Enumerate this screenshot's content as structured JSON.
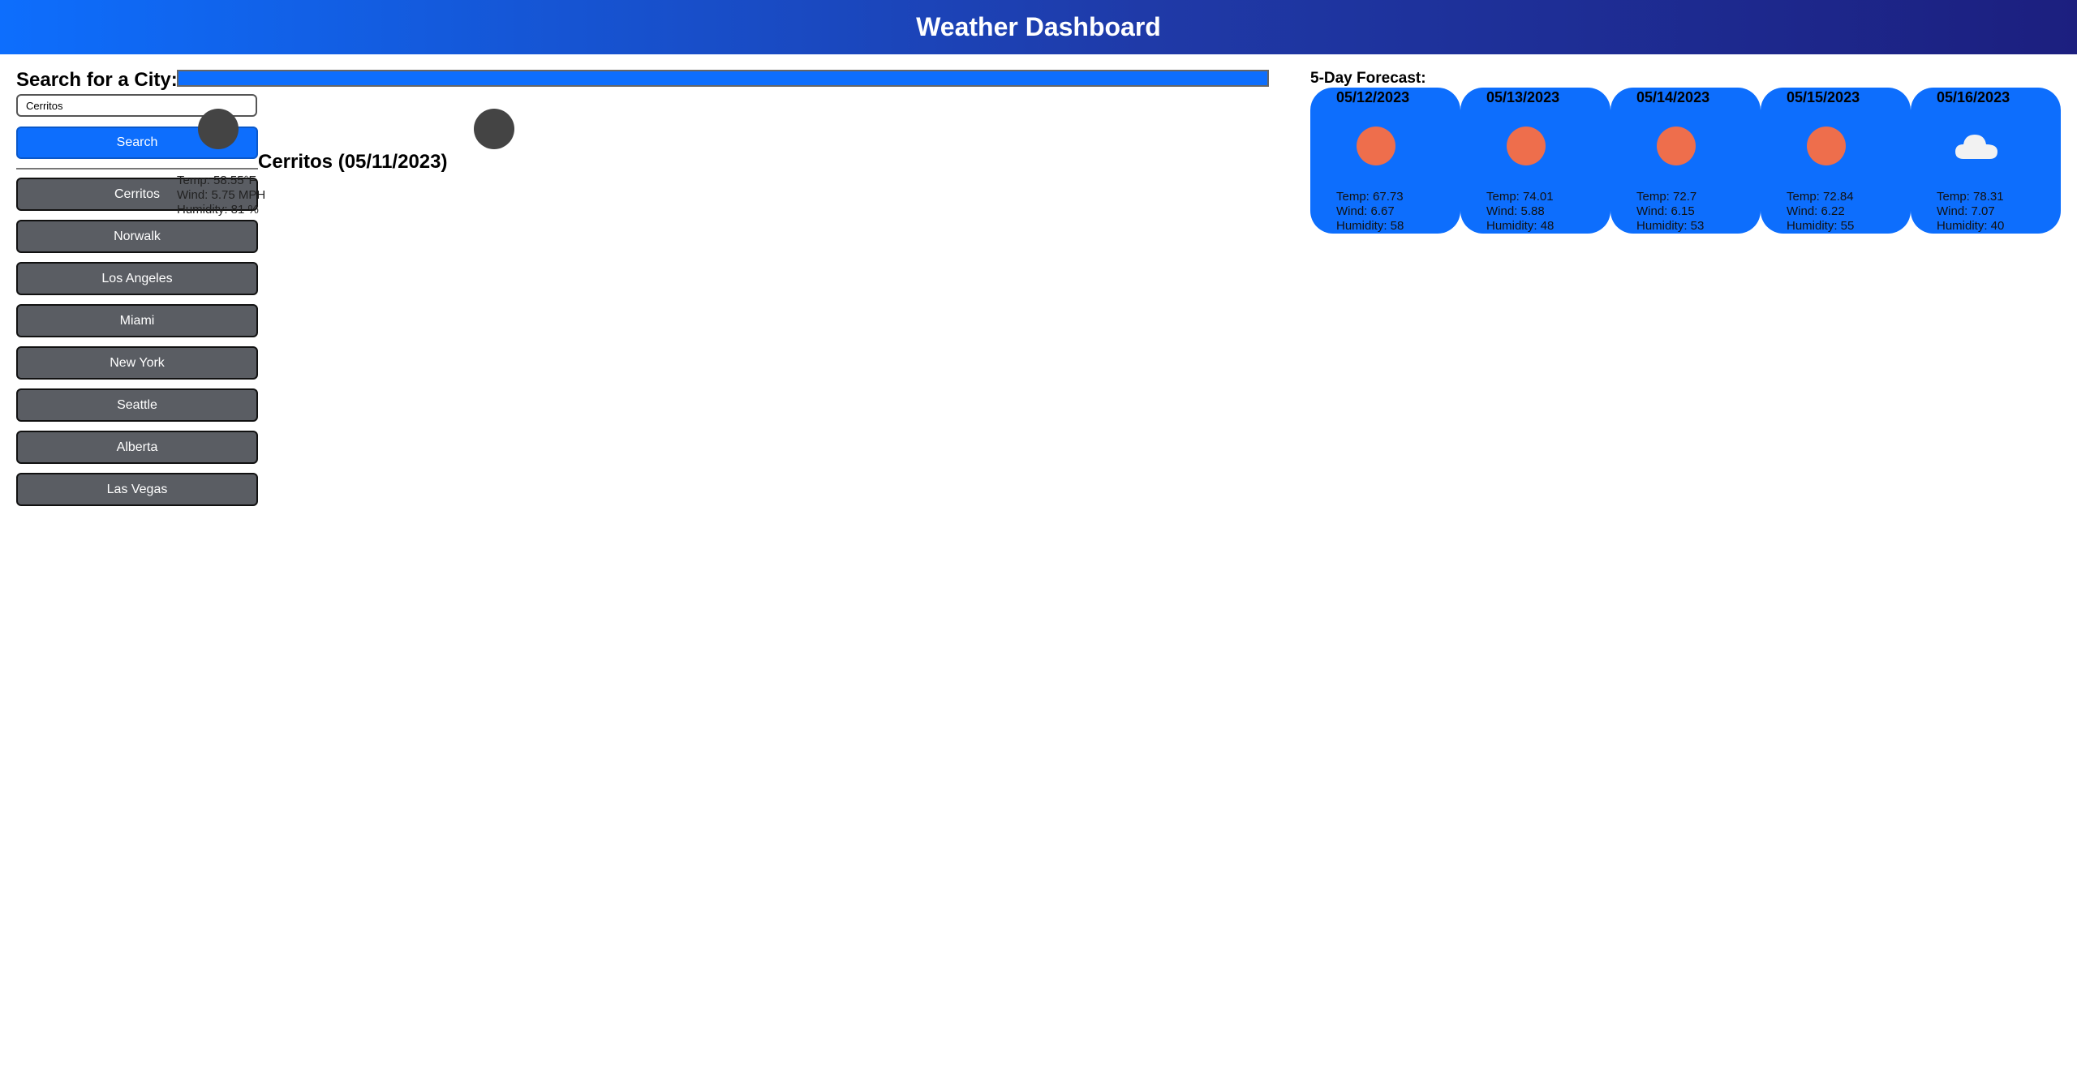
{
  "header": {
    "title": "Weather Dashboard"
  },
  "search": {
    "label": "Search for a City:",
    "input_value": "Cerritos",
    "button_label": "Search"
  },
  "history": {
    "cities": [
      "Cerritos",
      "Norwalk",
      "Los Angeles",
      "Miami",
      "New York",
      "Seattle",
      "Alberta",
      "Las Vegas"
    ]
  },
  "current": {
    "title": "Cerritos (05/11/2023)",
    "temp": "Temp: 58.55°F",
    "wind": "Wind: 5.75 MPH",
    "humidity": "Humidity: 81 %"
  },
  "forecast": {
    "label": "5-Day Forecast:",
    "days": [
      {
        "date": "05/12/2023",
        "icon": "sun-icon",
        "temp": "Temp: 67.73",
        "wind": "Wind: 6.67",
        "humidity": "Humidity: 58"
      },
      {
        "date": "05/13/2023",
        "icon": "sun-icon",
        "temp": "Temp: 74.01",
        "wind": "Wind: 5.88",
        "humidity": "Humidity: 48"
      },
      {
        "date": "05/14/2023",
        "icon": "sun-icon",
        "temp": "Temp: 72.7",
        "wind": "Wind: 6.15",
        "humidity": "Humidity: 53"
      },
      {
        "date": "05/15/2023",
        "icon": "sun-icon",
        "temp": "Temp: 72.84",
        "wind": "Wind: 6.22",
        "humidity": "Humidity: 55"
      },
      {
        "date": "05/16/2023",
        "icon": "cloud-icon",
        "temp": "Temp: 78.31",
        "wind": "Wind: 7.07",
        "humidity": "Humidity: 40"
      }
    ]
  },
  "colors": {
    "accent": "#0d6efd",
    "history_button": "#5a5d63",
    "sun": "#ee6e4c",
    "cloud": "#f2f2f2"
  }
}
